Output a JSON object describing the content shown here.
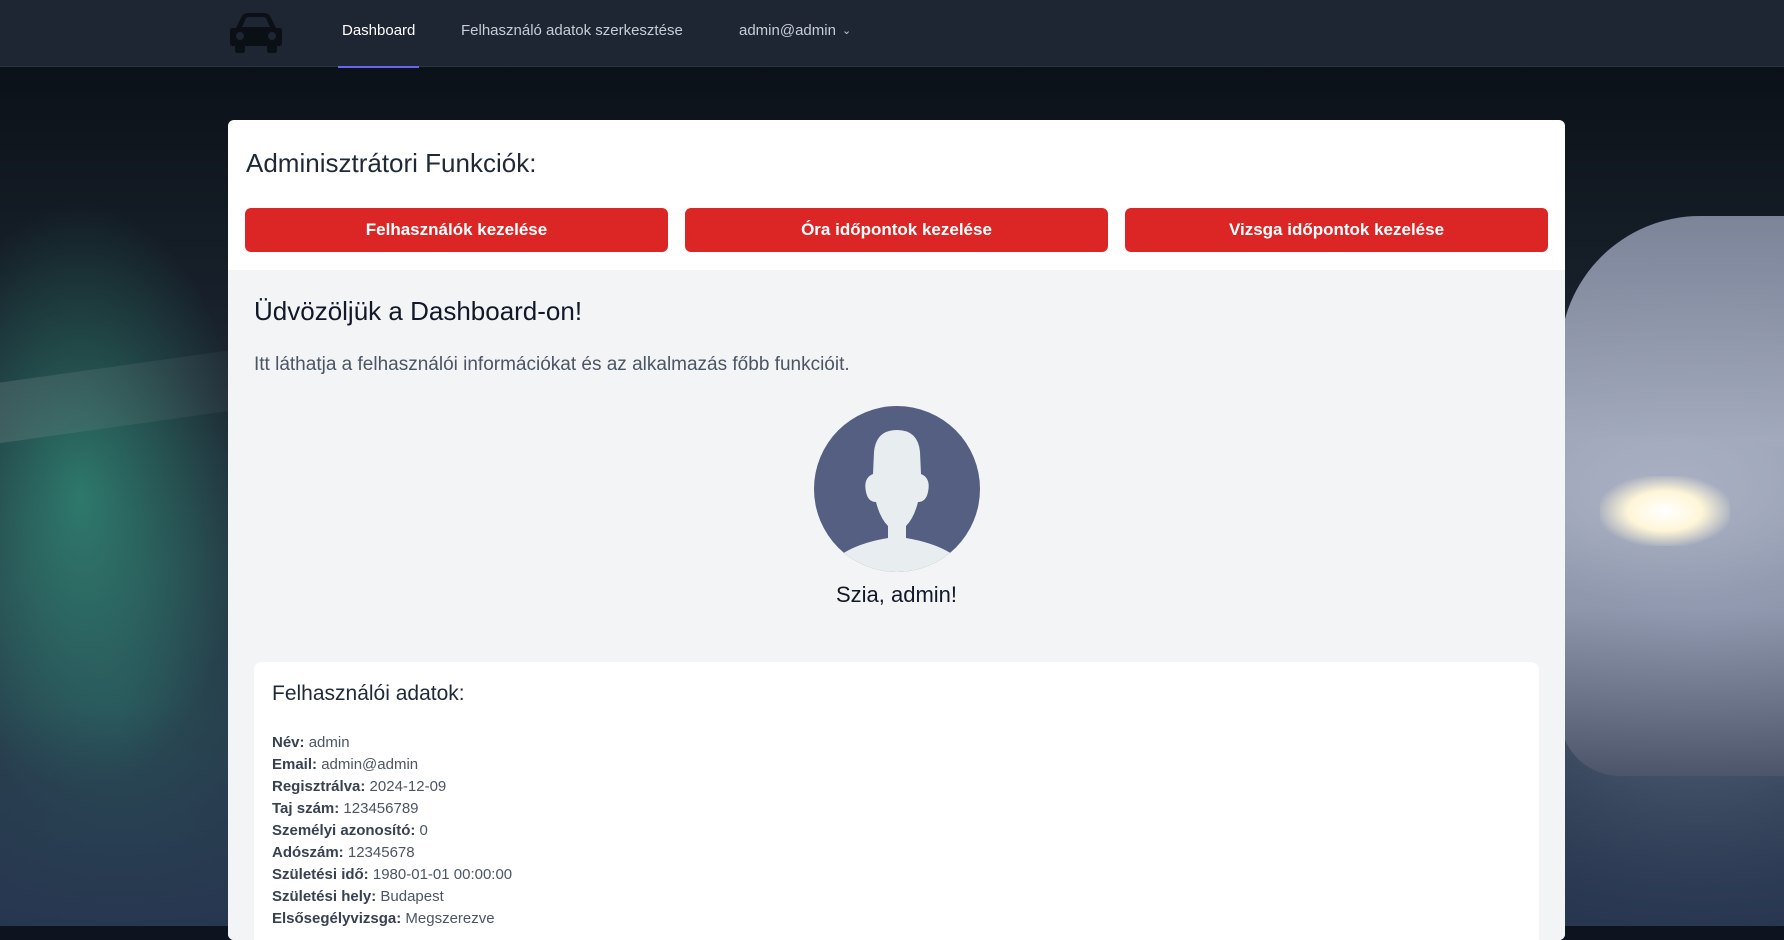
{
  "nav": {
    "links": [
      {
        "label": "Dashboard",
        "active": true
      },
      {
        "label": "Felhasználó adatok szerkesztése",
        "active": false
      }
    ],
    "user_menu_label": "admin@admin",
    "logo_icon": "car-icon",
    "active_accent": "#6366f1"
  },
  "admin": {
    "title": "Adminisztrátori Funkciók:",
    "buttons": [
      {
        "label": "Felhasználók kezelése"
      },
      {
        "label": "Óra időpontok kezelése"
      },
      {
        "label": "Vizsga időpontok kezelése"
      }
    ],
    "button_color": "#dc2626"
  },
  "welcome": {
    "title": "Üdvözöljük a Dashboard-on!",
    "text": "Itt láthatja a felhasználói információkat és az alkalmazás főbb funkcióit.",
    "avatar_icon": "user-avatar-icon",
    "greeting": "Szia, admin!"
  },
  "user_data": {
    "title": "Felhasználói adatok:",
    "fields": [
      {
        "label": "Név:",
        "value": "admin"
      },
      {
        "label": "Email:",
        "value": "admin@admin"
      },
      {
        "label": "Regisztrálva:",
        "value": "2024-12-09"
      },
      {
        "label": "Taj szám:",
        "value": "123456789"
      },
      {
        "label": "Személyi azonosító:",
        "value": "0"
      },
      {
        "label": "Adószám:",
        "value": "12345678"
      },
      {
        "label": "Születési idő:",
        "value": "1980-01-01 00:00:00"
      },
      {
        "label": "Születési hely:",
        "value": "Budapest"
      },
      {
        "label": "Elsősegélyvizsga:",
        "value": "Megszerezve"
      }
    ]
  }
}
